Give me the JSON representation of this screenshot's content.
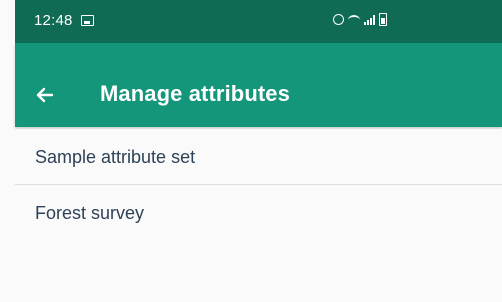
{
  "status_bar": {
    "time": "12:48",
    "icons": [
      "photo-icon",
      "alarm-icon",
      "wifi-icon",
      "signal-icon",
      "battery-icon"
    ]
  },
  "app_bar": {
    "back_icon": "arrow-left-icon",
    "title": "Manage attributes",
    "background_color": "#13967a"
  },
  "list": {
    "items": [
      {
        "label": "Sample attribute set"
      },
      {
        "label": "Forest survey"
      }
    ]
  },
  "colors": {
    "status_bar": "#0f6b54",
    "app_bar": "#13967a",
    "item_text": "#2d4257",
    "divider": "#dedede"
  }
}
